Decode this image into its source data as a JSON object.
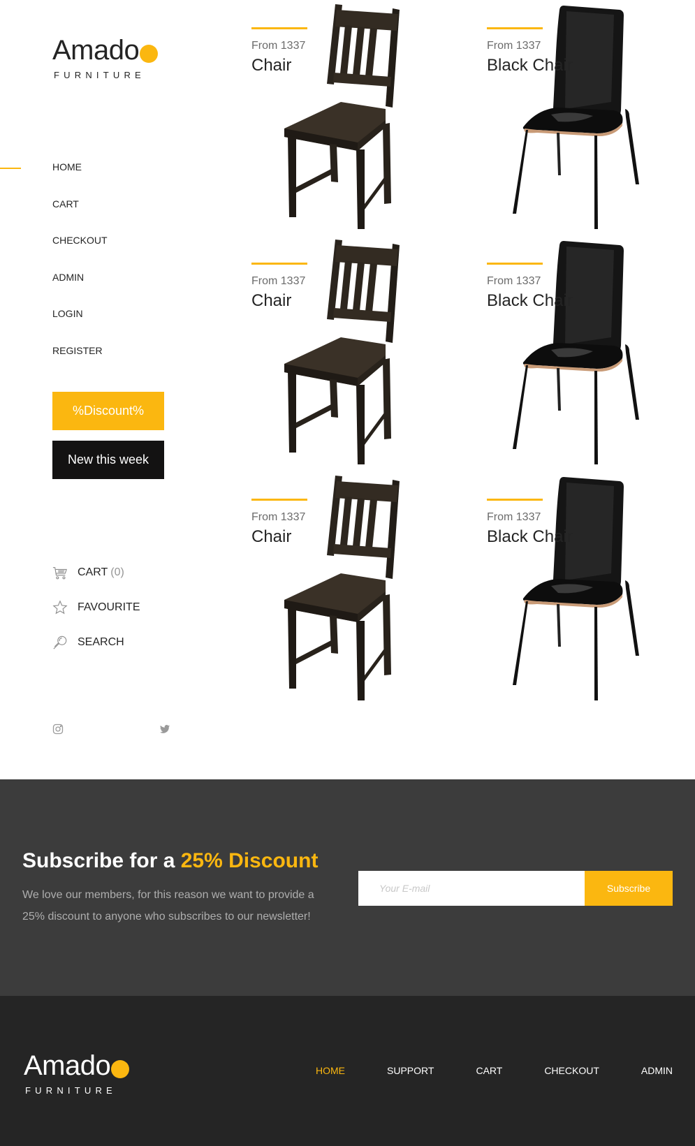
{
  "brand": {
    "name": "Amado",
    "tagline": "FURNITURE"
  },
  "colors": {
    "accent": "#fbb710",
    "dark": "#131212",
    "newsletter_bg": "#3c3c3c",
    "footer_bg": "#252525"
  },
  "sidebar": {
    "nav": [
      {
        "label": "HOME",
        "active": true
      },
      {
        "label": "CART"
      },
      {
        "label": "CHECKOUT"
      },
      {
        "label": "ADMIN"
      },
      {
        "label": "LOGIN"
      },
      {
        "label": "REGISTER"
      }
    ],
    "buttons": {
      "discount": "%Discount%",
      "new_week": "New this week"
    },
    "quick_links": {
      "cart": {
        "label": "CART",
        "count": "(0)",
        "icon": "cart-icon"
      },
      "favourite": {
        "label": "FAVOURITE",
        "icon": "star-icon"
      },
      "search": {
        "label": "SEARCH",
        "icon": "search-icon"
      }
    },
    "social": [
      "instagram-icon",
      "twitter-icon"
    ]
  },
  "products": [
    {
      "price": "From 1337",
      "name": "Chair",
      "image": "wooden-chair"
    },
    {
      "price": "From 1337",
      "name": "Black Chair",
      "image": "black-chair"
    },
    {
      "price": "From 1337",
      "name": "Chair",
      "image": "wooden-chair"
    },
    {
      "price": "From 1337",
      "name": "Black Chair",
      "image": "black-chair"
    },
    {
      "price": "From 1337",
      "name": "Chair",
      "image": "wooden-chair"
    },
    {
      "price": "From 1337",
      "name": "Black Chair",
      "image": "black-chair"
    }
  ],
  "newsletter": {
    "title_prefix": "Subscribe for a ",
    "title_accent": "25% Discount",
    "text": "We love our members, for this reason we want to provide a 25% discount to anyone who subscribes to our newsletter!",
    "placeholder": "Your E-mail",
    "button": "Subscribe"
  },
  "footer": {
    "nav": [
      {
        "label": "HOME",
        "active": true
      },
      {
        "label": "SUPPORT"
      },
      {
        "label": "CART"
      },
      {
        "label": "CHECKOUT"
      },
      {
        "label": "ADMIN"
      }
    ]
  }
}
